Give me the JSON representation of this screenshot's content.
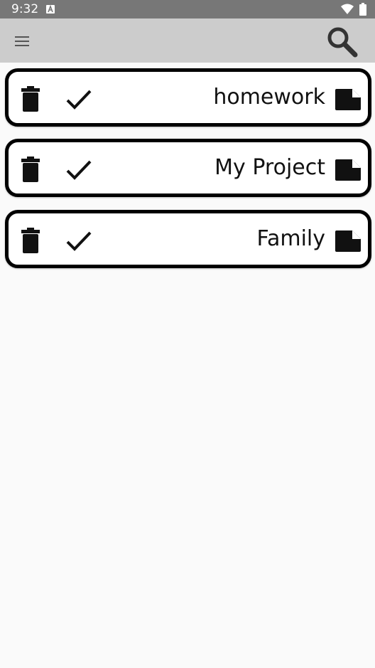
{
  "status": {
    "time": "9:32",
    "icons": [
      "a-notification-icon",
      "wifi-icon",
      "battery-icon"
    ]
  },
  "app_bar": {
    "icons": [
      "menu-icon",
      "search-icon"
    ]
  },
  "categories": [
    {
      "title": "homework"
    },
    {
      "title": "My Project"
    },
    {
      "title": "Family"
    }
  ],
  "colors": {
    "status_bar": "#777777",
    "app_bar": "#cccccc",
    "background": "#fafafa",
    "card_border": "#000000"
  }
}
